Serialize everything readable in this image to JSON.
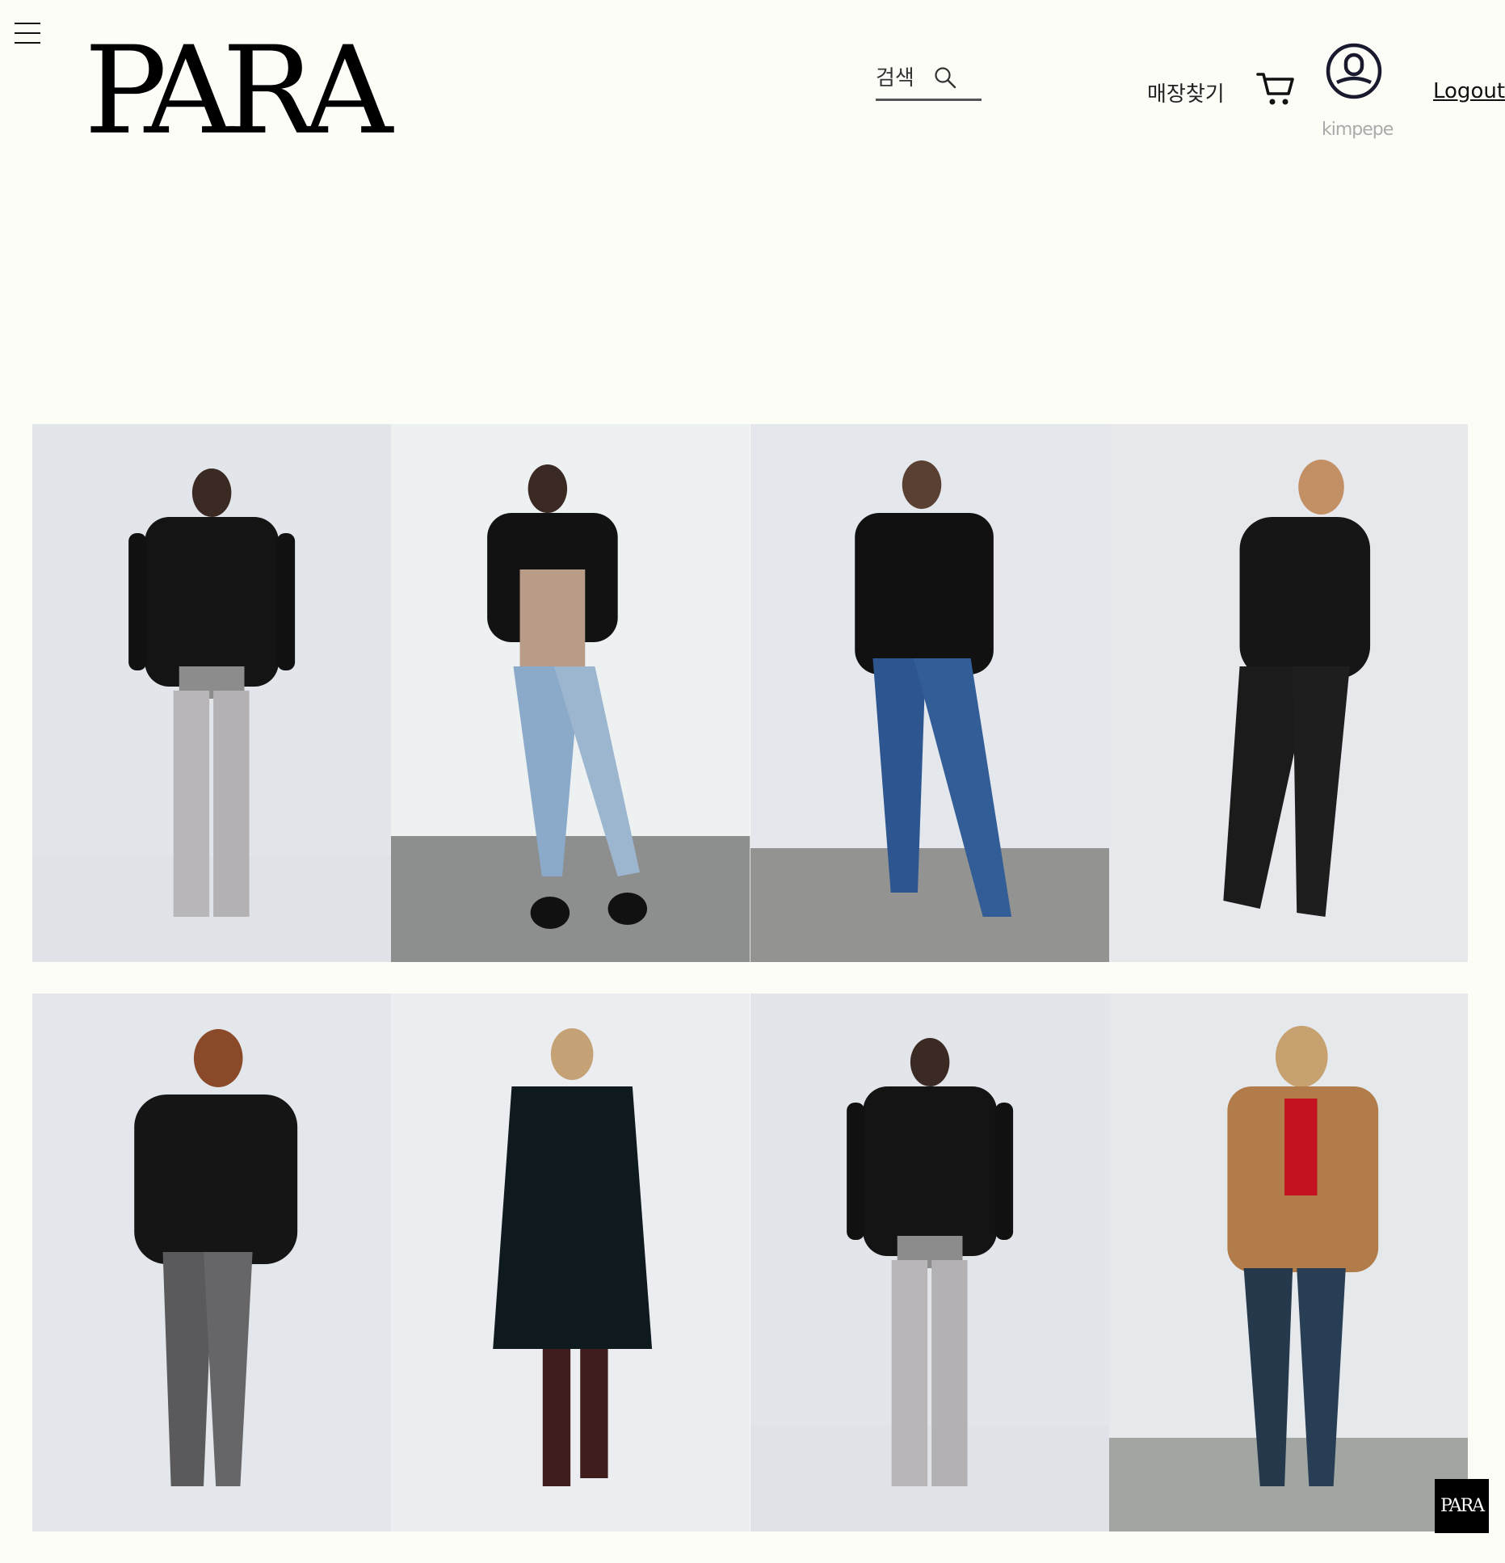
{
  "header": {
    "logo_text": "PARA",
    "search_placeholder": "검색",
    "store_link": "매장찾기",
    "username": "kimpepe",
    "logout_label": "Logout"
  },
  "products": {
    "row1": [
      "black-puffer-jacket",
      "cropped-black-puffer",
      "hooded-black-puffer",
      "leather-puffer-jacket"
    ],
    "row2": [
      "faux-fur-black-jacket",
      "long-wool-coat",
      "black-puffer-jacket",
      "camel-blazer-coat"
    ]
  },
  "floating_logo_text": "PARA",
  "colors": {
    "background": "#fdfdf8",
    "text": "#111111",
    "profile_icon": "#1a1a2e"
  }
}
